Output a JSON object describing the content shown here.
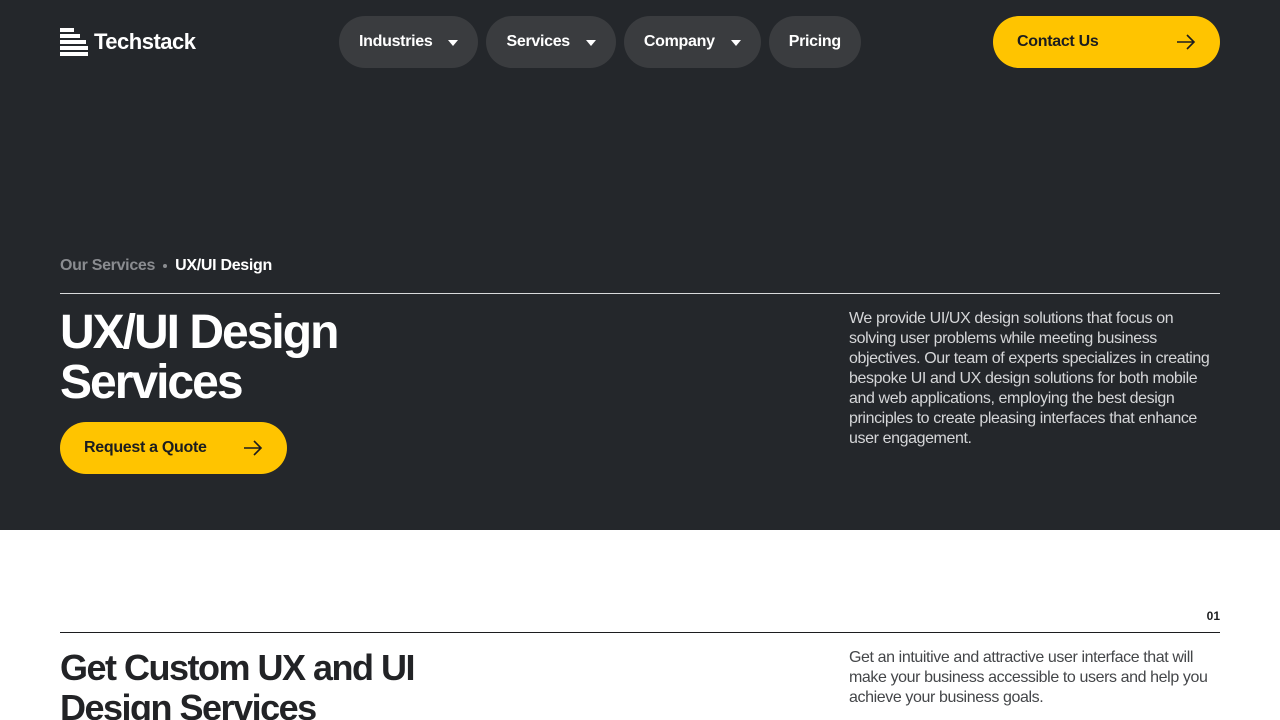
{
  "header": {
    "brand": "Techstack",
    "nav": [
      {
        "label": "Industries"
      },
      {
        "label": "Services"
      },
      {
        "label": "Company"
      },
      {
        "label": "Pricing"
      }
    ],
    "contact_label": "Contact Us"
  },
  "breadcrumb": {
    "parent": "Our Services",
    "current": "UX/UI Design"
  },
  "hero": {
    "title": "UX/UI Design Services",
    "cta_label": "Request a Quote",
    "description": "We provide UI/UX design solutions that focus on solving user problems while meeting business objectives. Our team of experts specializes in creating bespoke UI and UX design solutions for both mobile and web applications, employing the best design principles to create pleasing interfaces that enhance user engagement."
  },
  "section": {
    "number": "01",
    "title": "Get Custom UX and UI Design Services",
    "description": "Get an intuitive and attractive user interface that will make your business accessible to users and help you achieve your business goals."
  },
  "colors": {
    "hero_bg": "#24272b",
    "accent": "#ffc400",
    "pill_bg": "#3a3c3f"
  },
  "icons": {
    "logo": "stacked-bars-logo-icon",
    "dropdown": "caret-down-icon",
    "cta": "arrow-right-icon"
  }
}
